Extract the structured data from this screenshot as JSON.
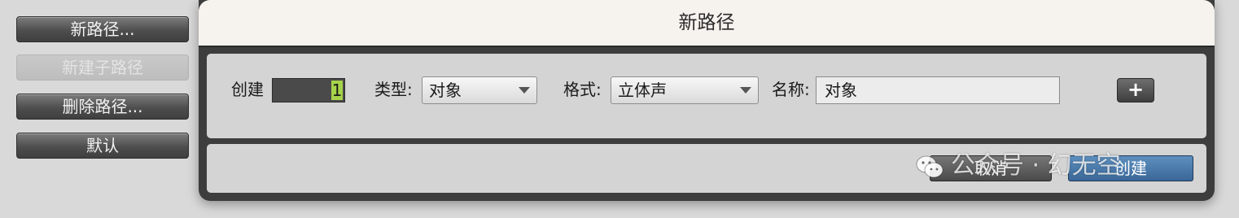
{
  "sidebar": {
    "buttons": [
      {
        "label": "新路径..."
      },
      {
        "label": "新建子路径"
      },
      {
        "label": "删除路径..."
      },
      {
        "label": "默认"
      }
    ]
  },
  "dialog": {
    "title": "新路径",
    "create_label": "创建",
    "count_value": "1",
    "type_label": "类型:",
    "type_value": "对象",
    "format_label": "格式:",
    "format_value": "立体声",
    "name_label": "名称:",
    "name_value": "对象",
    "add_button": "+",
    "cancel_button": "取消",
    "create_button": "创建"
  },
  "watermark": {
    "text": "公众号 · 幻无空"
  },
  "colors": {
    "accent": "#4a7aab",
    "count_highlight": "#a6d34a"
  }
}
